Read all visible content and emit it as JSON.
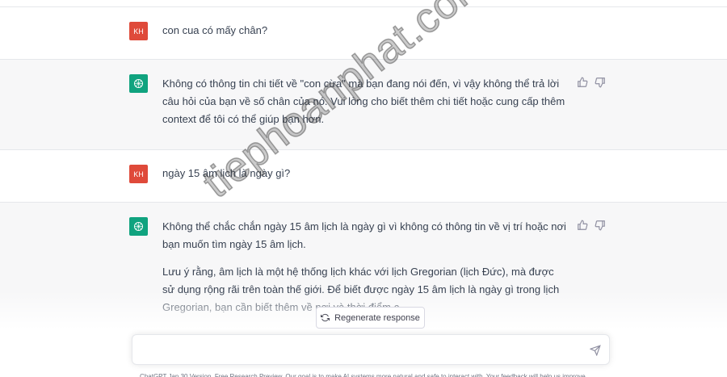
{
  "conversation": [
    {
      "role": "user",
      "avatar": "KH",
      "text": "con cua có mấy chân?"
    },
    {
      "role": "assistant",
      "paragraphs": [
        "Không có thông tin chi tiết về \"con cừa\" mà bạn đang nói đến, vì vậy không thể trả lời câu hỏi của bạn về số chân của nó. Vui lòng cho biết thêm chi tiết hoặc cung cấp thêm context để tôi có thể giúp bạn hơn."
      ]
    },
    {
      "role": "user",
      "avatar": "KH",
      "text": "ngày 15 âm lịch là ngày gì?"
    },
    {
      "role": "assistant",
      "paragraphs": [
        "Không thể chắc chắn ngày 15 âm lịch là ngày gì vì không có thông tin về vị trí hoặc nơi bạn muốn tìm ngày 15 âm lịch.",
        "Lưu ý rằng, âm lịch là một hệ thống lịch khác với lịch Gregorian (lịch Đức), mà được sử dụng rộng rãi trên toàn thế giới. Để biết được ngày 15 âm lịch là ngày gì trong lịch Gregorian, bạn cần biết thêm về nơi và thời điểm c"
      ]
    }
  ],
  "regenerate_label": "Regenerate response",
  "input": {
    "placeholder": ""
  },
  "footer": "ChatGPT Jan 30 Version. Free Research Preview. Our goal is to make AI systems more natural and safe to interact with. Your feedback will help us improve.",
  "watermark": "tiephoanphat.com",
  "colors": {
    "user_avatar": "#df4a3a",
    "bot_avatar": "#10a37f",
    "bot_row": "#f7f7f8"
  },
  "icons": {
    "feedback": [
      "thumbs-up-icon",
      "thumbs-down-icon"
    ],
    "regenerate": "refresh-icon",
    "send": "paper-plane-icon",
    "bot_avatar": "openai-logo-icon"
  }
}
